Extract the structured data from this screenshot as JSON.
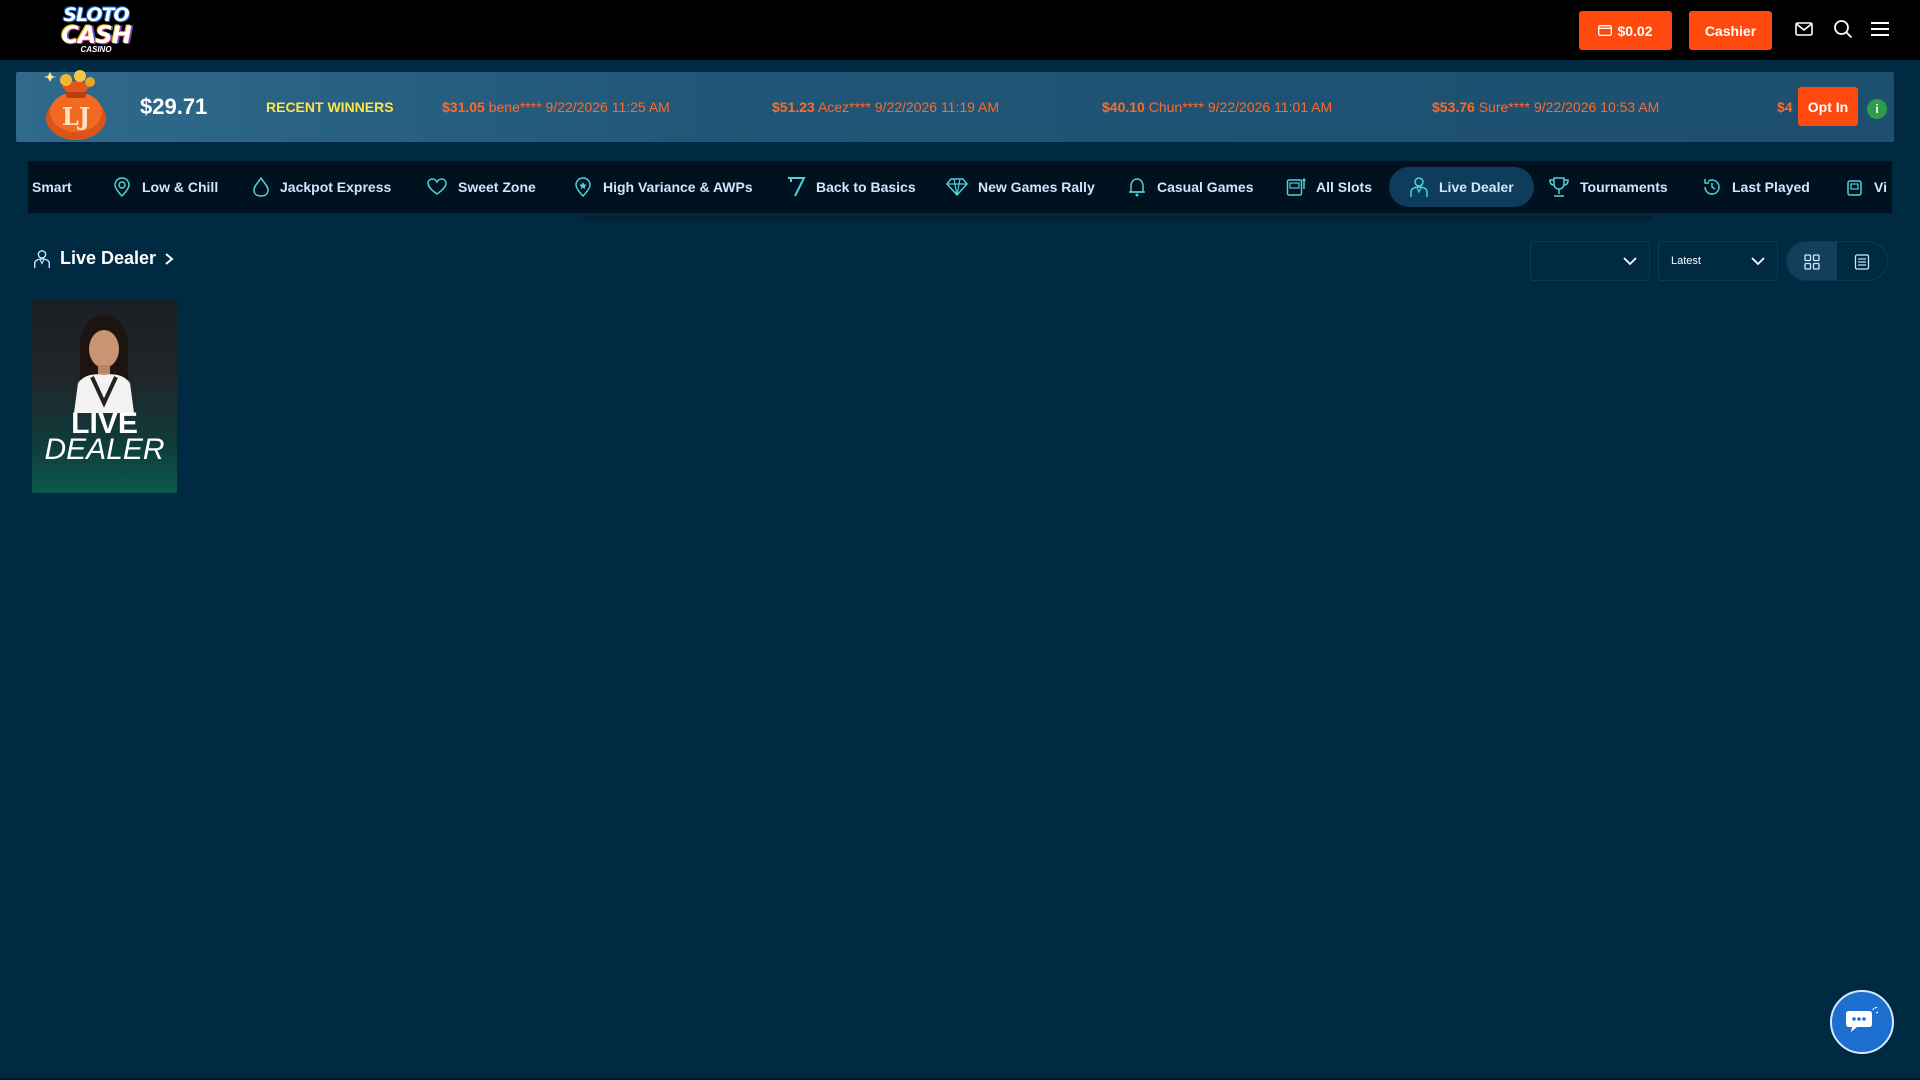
{
  "header": {
    "logo": {
      "line1": "SLOTO",
      "line2": "CASH",
      "line3": "CASINO"
    },
    "balance_label": "$0.02",
    "cashier_label": "Cashier",
    "icons": [
      "wallet-icon",
      "mail-icon",
      "search-icon",
      "menu-icon"
    ]
  },
  "jackpot": {
    "badge": "LJ",
    "amount": "$29.71",
    "recent_winners_label": "RECENT WINNERS",
    "winners": [
      {
        "amount": "$31.05",
        "name": "bene****",
        "time": "9/22/2026 11:25 AM"
      },
      {
        "amount": "$51.23",
        "name": "Acez****",
        "time": "9/22/2026 11:19 AM"
      },
      {
        "amount": "$40.10",
        "name": "Chun****",
        "time": "9/22/2026 11:01 AM"
      },
      {
        "amount": "$53.76",
        "name": "Sure****",
        "time": "9/22/2026 10:53 AM"
      },
      {
        "amount": "$4",
        "name": "",
        "time": ""
      }
    ],
    "optin_label": "Opt In",
    "info_label": "i"
  },
  "categories": [
    {
      "label": "Smart",
      "icon": "none"
    },
    {
      "label": "Low & Chill",
      "icon": "badge-icon"
    },
    {
      "label": "Jackpot Express",
      "icon": "flame-icon"
    },
    {
      "label": "Sweet Zone",
      "icon": "candy-heart-icon"
    },
    {
      "label": "High Variance & AWPs",
      "icon": "badge-star-icon"
    },
    {
      "label": "Back to Basics",
      "icon": "seven-icon"
    },
    {
      "label": "New Games Rally",
      "icon": "diamond-icon"
    },
    {
      "label": "Casual Games",
      "icon": "bell-icon"
    },
    {
      "label": "All Slots",
      "icon": "slot-machine-icon"
    },
    {
      "label": "Live Dealer",
      "icon": "dealer-icon",
      "active": true
    },
    {
      "label": "Tournaments",
      "icon": "trophy-icon"
    },
    {
      "label": "Last Played",
      "icon": "history-icon"
    },
    {
      "label": "Vi",
      "icon": "video-icon"
    }
  ],
  "section": {
    "title": "Live Dealer",
    "filter_value": "",
    "sort_value": "Latest"
  },
  "games": [
    {
      "line1": "LIVE",
      "line2": "DEALER"
    }
  ],
  "colors": {
    "accent": "#ff4a0f",
    "background": "#002a42",
    "winner_text": "#ff6a2a",
    "label_yellow": "#ffe34d"
  }
}
